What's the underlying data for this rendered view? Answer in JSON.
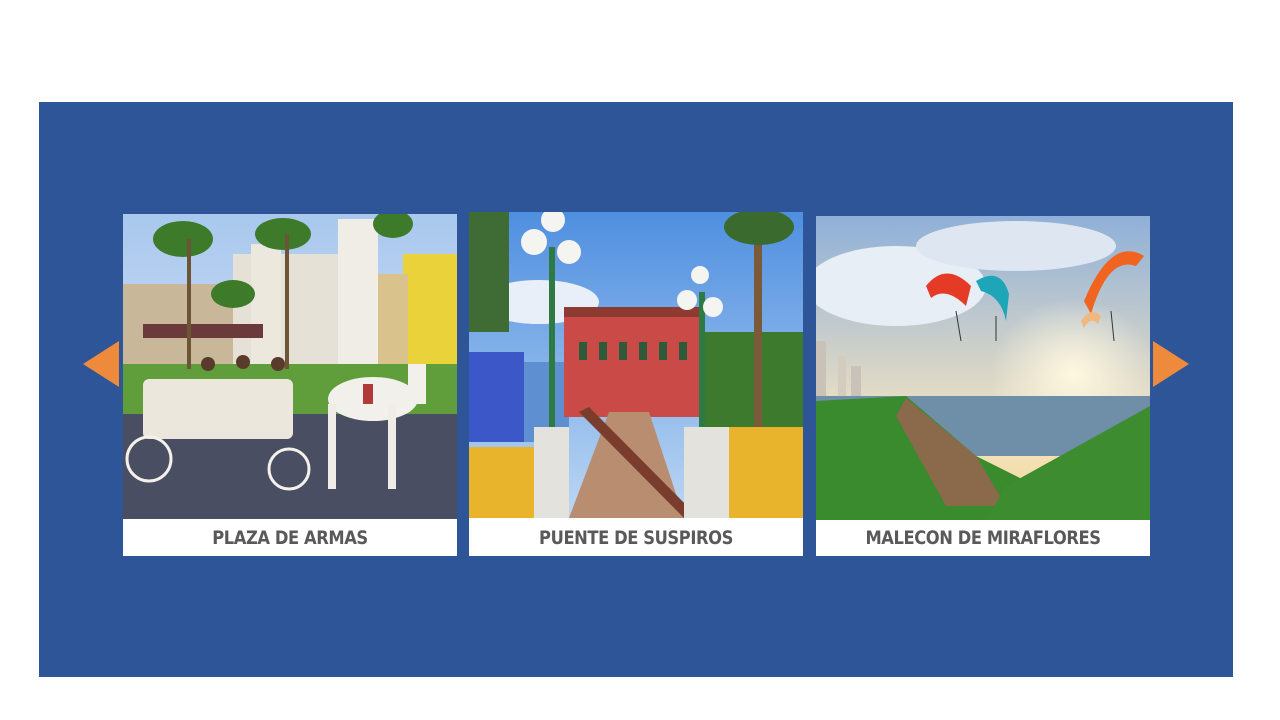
{
  "carousel": {
    "prev_icon": "triangle-left-arrow",
    "next_icon": "triangle-right-arrow",
    "accent_color": "#ee8a3c",
    "panel_color": "#2e5597",
    "cards": [
      {
        "caption": "PLAZA DE ARMAS",
        "image": "plaza-de-armas-photo"
      },
      {
        "caption": "PUENTE DE SUSPIROS",
        "image": "puente-de-suspiros-photo"
      },
      {
        "caption": "MALECON DE MIRAFLORES",
        "image": "malecon-de-miraflores-photo"
      }
    ]
  }
}
